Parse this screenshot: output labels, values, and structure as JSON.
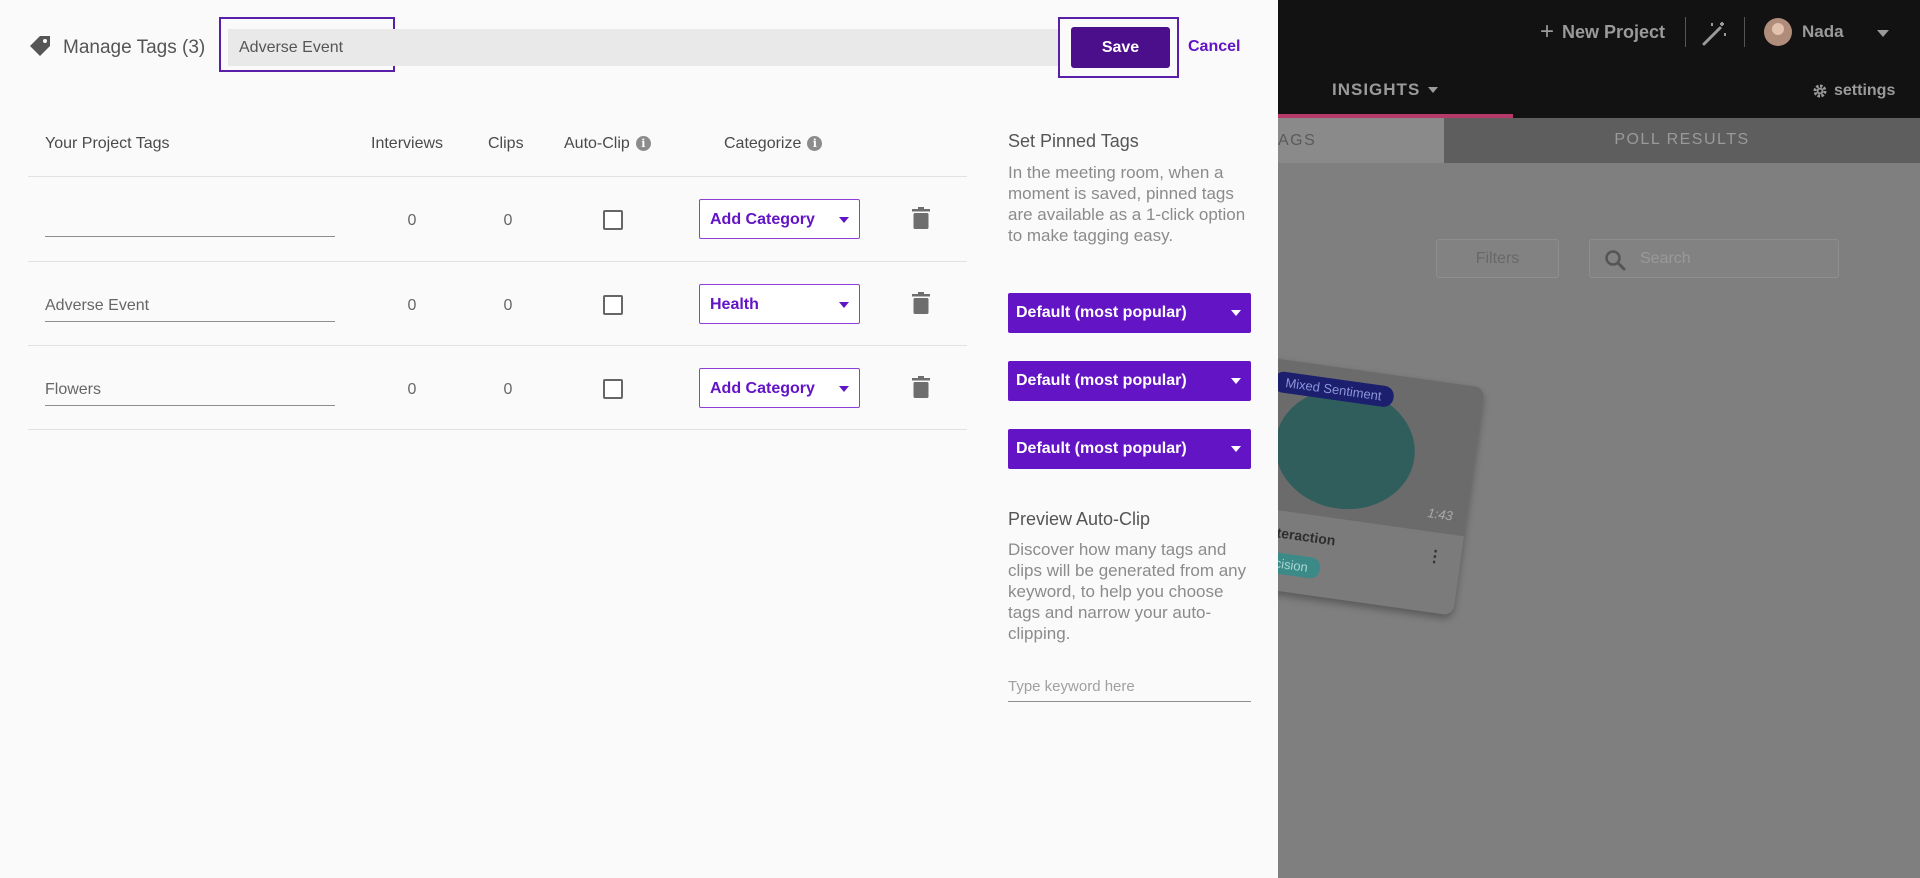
{
  "header": {
    "title": "Manage Tags (3)",
    "tag_input_value": "Adverse Event",
    "save_label": "Save",
    "cancel_label": "Cancel"
  },
  "columns": {
    "tags": "Your Project Tags",
    "interviews": "Interviews",
    "clips": "Clips",
    "autoclip": "Auto-Clip",
    "categorize": "Categorize"
  },
  "rows": [
    {
      "name": "",
      "interviews": "0",
      "clips": "0",
      "auto_clip": false,
      "category": "Add Category"
    },
    {
      "name": "Adverse Event",
      "interviews": "0",
      "clips": "0",
      "auto_clip": false,
      "category": "Health"
    },
    {
      "name": "Flowers",
      "interviews": "0",
      "clips": "0",
      "auto_clip": false,
      "category": "Add Category"
    }
  ],
  "pinned": {
    "heading": "Set Pinned Tags",
    "description": "In the meeting room, when a moment is saved, pinned tags are available as a 1-click option to make tagging easy.",
    "options": [
      "Default (most popular)",
      "Default (most popular)",
      "Default (most popular)"
    ]
  },
  "preview": {
    "heading": "Preview Auto-Clip",
    "description": "Discover how many tags and clips will be generated from any keyword, to help you choose tags and narrow your auto-clipping.",
    "keyword_placeholder": "Type keyword here"
  },
  "background": {
    "new_project": "New Project",
    "user_name": "Nada",
    "insights_label": "INSIGHTS",
    "settings_label": "settings",
    "tab_partial": "AGS",
    "tab_poll": "POLL RESULTS",
    "filters_label": "Filters",
    "search_placeholder": "Search",
    "card_sentiment": "Mixed Sentiment",
    "card_duration": "1:43",
    "card_title": "e Interaction",
    "card_tag": "decision"
  },
  "colors": {
    "primary": "#6314c5",
    "primary_dark": "#4b0f8c",
    "focus_outline": "#5a1fa8"
  }
}
